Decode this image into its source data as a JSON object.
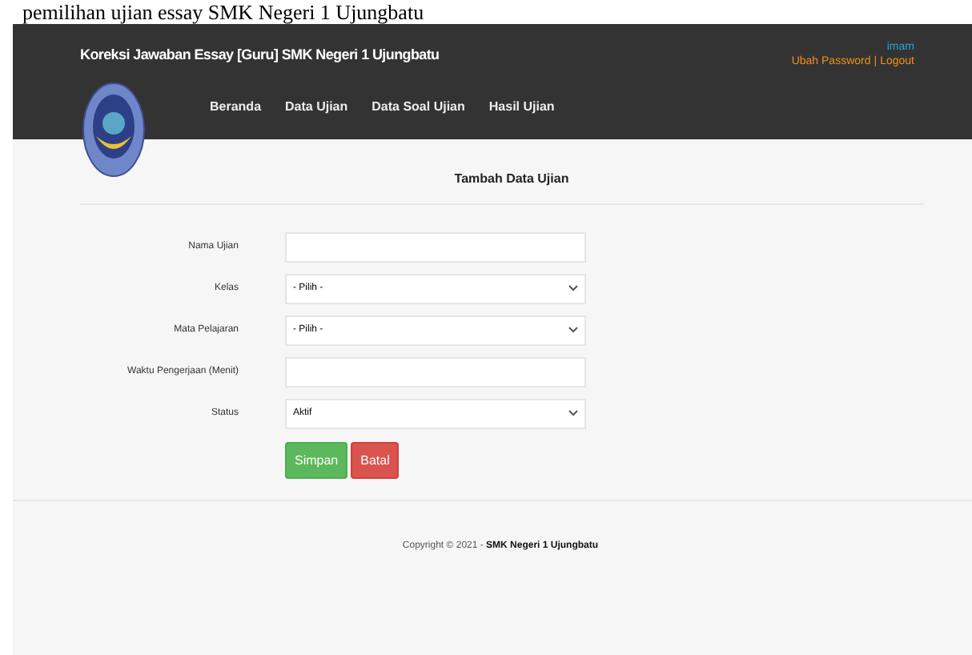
{
  "caption": "pemilihan ujian essay SMK Negeri 1 Ujungbatu",
  "header": {
    "title": "Koreksi Jawaban Essay [Guru] SMK Negeri 1 Ujungbatu",
    "user": "imam",
    "links": [
      "Ubah Password",
      "Logout"
    ],
    "separator": "|"
  },
  "nav": [
    "Beranda",
    "Data Ujian",
    "Data Soal Ujian",
    "Hasil Ujian"
  ],
  "form": {
    "title": "Tambah Data Ujian",
    "fields": [
      {
        "label": "Nama Ujian",
        "kind": "text"
      },
      {
        "label": "Kelas",
        "kind": "select",
        "value": "- Pilih -"
      },
      {
        "label": "Mata Pelajaran",
        "kind": "select",
        "value": "- Pilih -"
      },
      {
        "label": "Waktu Pengerjaan (Menit)",
        "kind": "text"
      },
      {
        "label": "Status",
        "kind": "select",
        "value": "Aktif"
      }
    ],
    "buttons": [
      {
        "label": "Simpan",
        "kind": "success"
      },
      {
        "label": "Batal",
        "kind": "danger"
      }
    ]
  },
  "footer": {
    "text": "Copyright © 2021 - **SMK Negeri 1 Ujungbatu**"
  }
}
